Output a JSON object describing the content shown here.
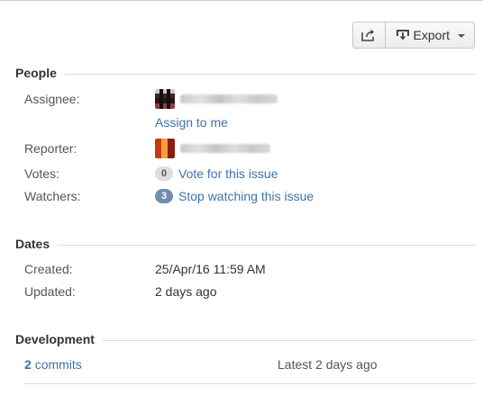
{
  "toolbar": {
    "share_icon": "share-icon",
    "export_label": "Export",
    "export_icon": "export-icon"
  },
  "people": {
    "title": "People",
    "assignee_label": "Assignee:",
    "assignee_name": "",
    "assign_to_me": "Assign to me",
    "reporter_label": "Reporter:",
    "reporter_name": "",
    "votes_label": "Votes:",
    "votes_count": "0",
    "vote_link": "Vote for this issue",
    "watchers_label": "Watchers:",
    "watchers_count": "3",
    "watch_link": "Stop watching this issue"
  },
  "dates": {
    "title": "Dates",
    "created_label": "Created:",
    "created_value": "25/Apr/16 11:59 AM",
    "updated_label": "Updated:",
    "updated_value": "2 days ago"
  },
  "development": {
    "title": "Development",
    "commits_count": "2",
    "commits_label": "commits",
    "latest": "Latest 2 days ago"
  },
  "colors": {
    "link": "#3b73af",
    "badge_blue": "#6f8fae",
    "badge_grey": "#dedede",
    "text": "#333333"
  }
}
